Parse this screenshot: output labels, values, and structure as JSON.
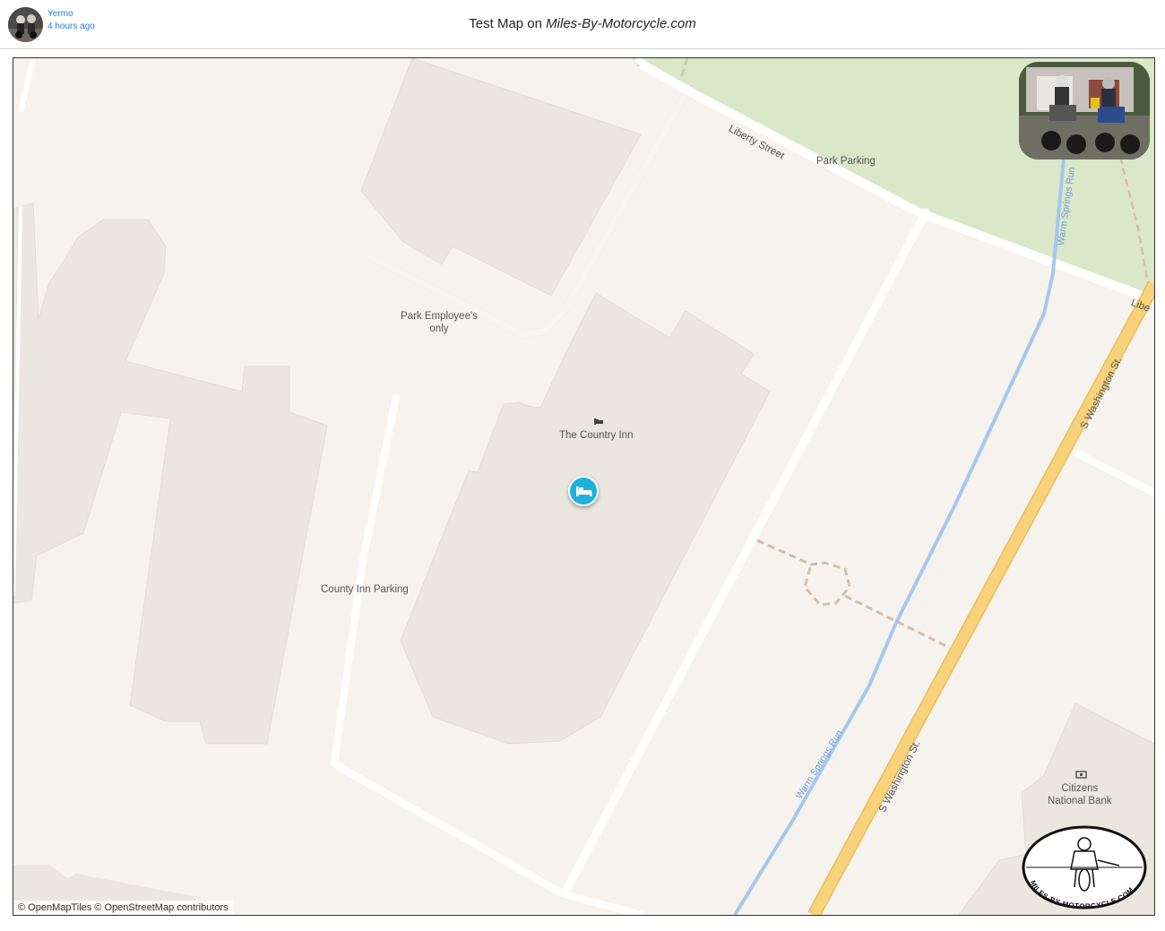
{
  "header": {
    "author_name": "Yermo",
    "timestamp": "4 hours ago",
    "title_prefix": "Test Map on ",
    "title_site": "Miles-By-Motorcycle.com"
  },
  "map": {
    "labels": {
      "liberty_street": "Liberty Street",
      "liberty_street_edge": "Libe",
      "park_parking": "Park Parking",
      "park_employees_line1": "Park Employee's",
      "park_employees_line2": "only",
      "country_inn": "The Country Inn",
      "county_inn_parking": "County Inn Parking",
      "s_washington_upper": "S Washington St.",
      "s_washington_lower": "S Washington St.",
      "warm_springs_upper": "Warm Springs Run",
      "warm_springs_lower": "Warm Springs Run",
      "citizens_bank_line1": "Citizens",
      "citizens_bank_line2": "National Bank"
    },
    "marker": {
      "type": "hotel",
      "icon": "bed-icon"
    },
    "logo_text": "MILES-BY-MOTORCYCLE.COM",
    "attribution": "© OpenMapTiles © OpenStreetMap contributors",
    "colors": {
      "background": "#f6f3ef",
      "building": "#ebe6e0",
      "park": "#dae7c8",
      "road": "#ffffff",
      "main_road": "#f8d27a",
      "stream": "#a4c8ee",
      "path": "#d3bfa6",
      "marker": "#1eb0de"
    }
  }
}
